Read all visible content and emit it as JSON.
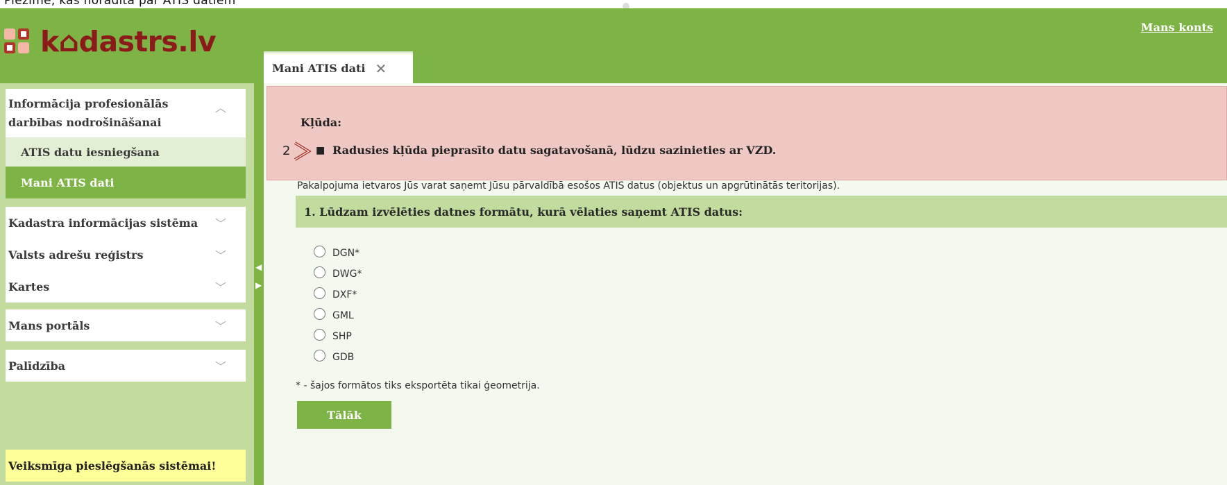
{
  "top_text": "Piezīme, kas norādīta par ATIS datiem",
  "brand": {
    "logo_text": "k⌂dastrs.lv"
  },
  "header": {
    "account_link": "Mans konts"
  },
  "tab": {
    "label": "Mani ATIS dati",
    "close_icon": "close-icon"
  },
  "sidebar": {
    "section_title": "Informācija profesionālās darbības nodrošināšanai",
    "sub_items": [
      "ATIS datu iesniegšana",
      "Mani ATIS dati"
    ],
    "items": [
      "Kadastra informācijas sistēma",
      "Valsts adrešu reģistrs",
      "Kartes",
      "Mans portāls",
      "Palīdzība"
    ],
    "notice": "Veiksmīga pieslēgšanās sistēmai!"
  },
  "error": {
    "title": "Kļūda:",
    "number": "2",
    "message": "Radusies kļūda pieprasīto datu sagatavošanā, lūdzu sazinieties ar VZD."
  },
  "main": {
    "intro": "Pakalpojuma ietvaros Jūs varat saņemt Jūsu pārvaldībā esošos ATIS datus (objektus un apgrūtinātās teritorijas).",
    "step_title": "1. Lūdzam izvēlēties datnes formātu, kurā vēlaties saņemt ATIS datus:",
    "formats": [
      "DGN*",
      "DWG*",
      "DXF*",
      "GML",
      "SHP",
      "GDB"
    ],
    "note": "* - šajos formātos tiks eksportēta tikai ģeometrija.",
    "next_button": "Tālāk"
  },
  "colors": {
    "brand_green": "#7db445",
    "light_green": "#c2db9e",
    "error_bg": "#efc8c3",
    "logo_red": "#8b1a1a"
  }
}
